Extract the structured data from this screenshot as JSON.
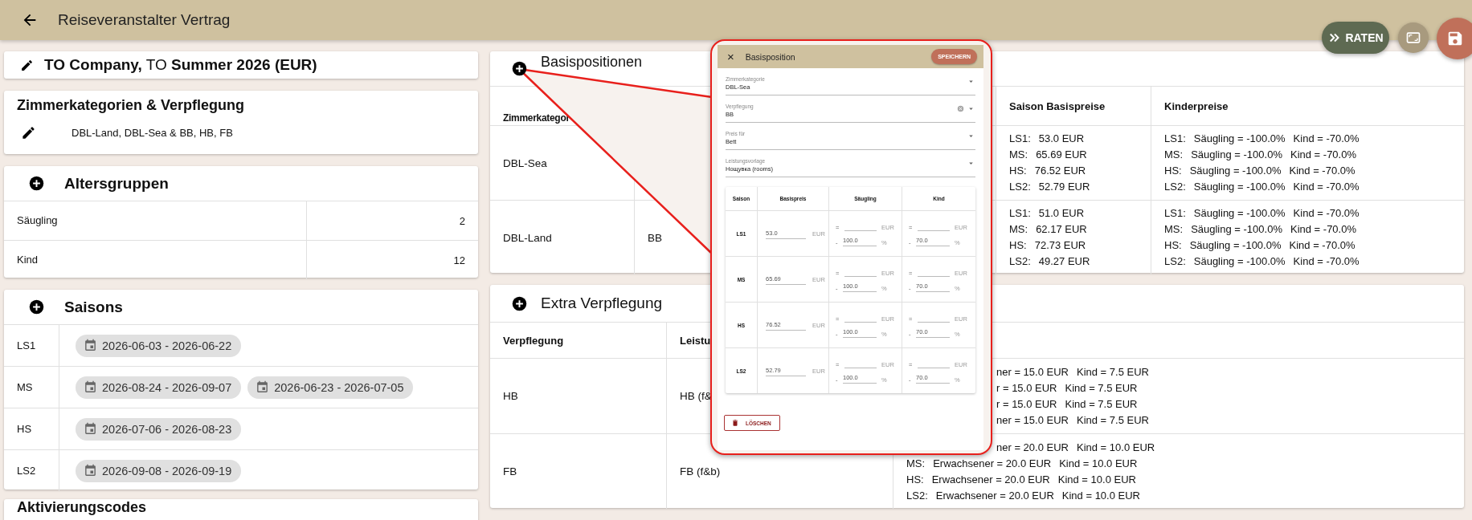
{
  "app_bar": {
    "title": "Reiseveranstalter Vertrag"
  },
  "fab_buttons": [
    {
      "kind": "raten",
      "label": "RATEN"
    },
    {
      "kind": "fullscreen"
    },
    {
      "kind": "save"
    }
  ],
  "contract_card": {
    "title": "**TO Company,** TO **Summer 2026 (EUR)**"
  },
  "room_board_card": {
    "title": "Zimmerkategorien & Verpflegung",
    "summary": "DBL-Land, DBL-Sea & BB, HB, FB"
  },
  "age_groups": {
    "title": "Altersgruppen",
    "rows": [
      {
        "name": "Säugling",
        "max_age": "2"
      },
      {
        "name": "Kind",
        "max_age": "12"
      }
    ]
  },
  "seasons": {
    "title": "Saisons",
    "rows": [
      {
        "code": "LS1",
        "ranges": [
          "2026-06-03 - 2026-06-22"
        ]
      },
      {
        "code": "MS",
        "ranges": [
          "2026-08-24 - 2026-09-07",
          "2026-06-23 - 2026-07-05"
        ]
      },
      {
        "code": "HS",
        "ranges": [
          "2026-07-06 - 2026-08-23"
        ]
      },
      {
        "code": "LS2",
        "ranges": [
          "2026-09-08 - 2026-09-19"
        ]
      }
    ]
  },
  "activation_codes": {
    "title": "Aktivierungscodes"
  },
  "base_positions": {
    "title": "Basispositionen",
    "col_room": "Zimmerkategor",
    "col_prices": "Saison Basispreise",
    "col_child": "Kinderpreise",
    "rows": [
      {
        "room": "DBL-Sea",
        "prices": [
          {
            "season": "LS1:",
            "value": "53.0 EUR"
          },
          {
            "season": "MS:",
            "value": "65.69 EUR"
          },
          {
            "season": "HS:",
            "value": "76.52 EUR"
          },
          {
            "season": "LS2:",
            "value": "52.79 EUR"
          }
        ],
        "child_prices": [
          {
            "season": "LS1:",
            "infant": "Säugling = -100.0%",
            "child": "Kind = -70.0%"
          },
          {
            "season": "MS:",
            "infant": "Säugling = -100.0%",
            "child": "Kind = -70.0%"
          },
          {
            "season": "HS:",
            "infant": "Säugling = -100.0%",
            "child": "Kind = -70.0%"
          },
          {
            "season": "LS2:",
            "infant": "Säugling = -100.0%",
            "child": "Kind = -70.0%"
          }
        ]
      },
      {
        "room": "DBL-Land",
        "board": "BB",
        "prices": [
          {
            "season": "LS1:",
            "value": "51.0 EUR"
          },
          {
            "season": "MS:",
            "value": "62.17 EUR"
          },
          {
            "season": "HS:",
            "value": "72.73 EUR"
          },
          {
            "season": "LS2:",
            "value": "49.27 EUR"
          }
        ],
        "child_prices": [
          {
            "season": "LS1:",
            "infant": "Säugling = -100.0%",
            "child": "Kind = -70.0%"
          },
          {
            "season": "MS:",
            "infant": "Säugling = -100.0%",
            "child": "Kind = -70.0%"
          },
          {
            "season": "HS:",
            "infant": "Säugling = -100.0%",
            "child": "Kind = -70.0%"
          },
          {
            "season": "LS2:",
            "infant": "Säugling = -100.0%",
            "child": "Kind = -70.0%"
          }
        ]
      }
    ]
  },
  "extra_boards": {
    "title": "Extra Verpflegung",
    "col_board": "Verpflegung",
    "col_service": "Leistu",
    "rows": [
      {
        "board": "HB",
        "service": "HB (f&",
        "lines": [
          {
            "clipped": true,
            "adult": "ner = 15.0 EUR",
            "child": "Kind = 7.5 EUR"
          },
          {
            "clipped": true,
            "adult": "r = 15.0 EUR",
            "child": "Kind = 7.5 EUR"
          },
          {
            "clipped": true,
            "adult": "r = 15.0 EUR",
            "child": "Kind = 7.5 EUR"
          },
          {
            "clipped": true,
            "adult": "ner = 15.0 EUR",
            "child": "Kind = 7.5 EUR"
          }
        ]
      },
      {
        "board": "FB",
        "service": "FB (f&b)",
        "lines": [
          {
            "clipped": true,
            "adult": "ner = 20.0 EUR",
            "child": "Kind = 10.0 EUR"
          },
          {
            "season": "MS:",
            "adult": "Erwachsener = 20.0 EUR",
            "child": "Kind = 10.0 EUR"
          },
          {
            "season": "HS:",
            "adult": "Erwachsener = 20.0 EUR",
            "child": "Kind = 10.0 EUR"
          },
          {
            "season": "LS2:",
            "adult": "Erwachsener = 20.0 EUR",
            "child": "Kind = 10.0 EUR"
          }
        ]
      }
    ]
  },
  "dialog": {
    "close_glyph": "×",
    "title": "Basisposition",
    "save_label": "SPEICHERN",
    "fields": [
      {
        "label": "Zimmerkategorie",
        "value": "DBL-Sea",
        "clearable": false
      },
      {
        "label": "Verpflegung",
        "value": "BB",
        "clearable": true
      },
      {
        "label": "Preis für",
        "value": "Bett",
        "clearable": false
      },
      {
        "label": "Leistungsvorlage",
        "value": "Нощувка (rooms)",
        "clearable": false
      }
    ],
    "columns": [
      "Saison",
      "Basispreis",
      "Säugling",
      "Kind"
    ],
    "rows": [
      {
        "season": "LS1",
        "price": "53.0",
        "currency": "EUR",
        "infant": {
          "eq": "=",
          "unit": "EUR",
          "minus": "-",
          "percent": "100.0",
          "pct": "%"
        },
        "child": {
          "eq": "=",
          "unit": "EUR",
          "minus": "-",
          "percent": "70.0",
          "pct": "%"
        }
      },
      {
        "season": "MS",
        "price": "65.69",
        "currency": "EUR",
        "infant": {
          "eq": "=",
          "unit": "EUR",
          "minus": "-",
          "percent": "100.0",
          "pct": "%"
        },
        "child": {
          "eq": "=",
          "unit": "EUR",
          "minus": "-",
          "percent": "70.0",
          "pct": "%"
        }
      },
      {
        "season": "HS",
        "price": "76.52",
        "currency": "EUR",
        "infant": {
          "eq": "=",
          "unit": "EUR",
          "minus": "-",
          "percent": "100.0",
          "pct": "%"
        },
        "child": {
          "eq": "=",
          "unit": "EUR",
          "minus": "-",
          "percent": "70.0",
          "pct": "%"
        }
      },
      {
        "season": "LS2",
        "price": "52.79",
        "currency": "EUR",
        "infant": {
          "eq": "=",
          "unit": "EUR",
          "minus": "-",
          "percent": "100.0",
          "pct": "%"
        },
        "child": {
          "eq": "=",
          "unit": "EUR",
          "minus": "-",
          "percent": "70.0",
          "pct": "%"
        }
      }
    ],
    "delete_label": "LÖSCHEN"
  }
}
